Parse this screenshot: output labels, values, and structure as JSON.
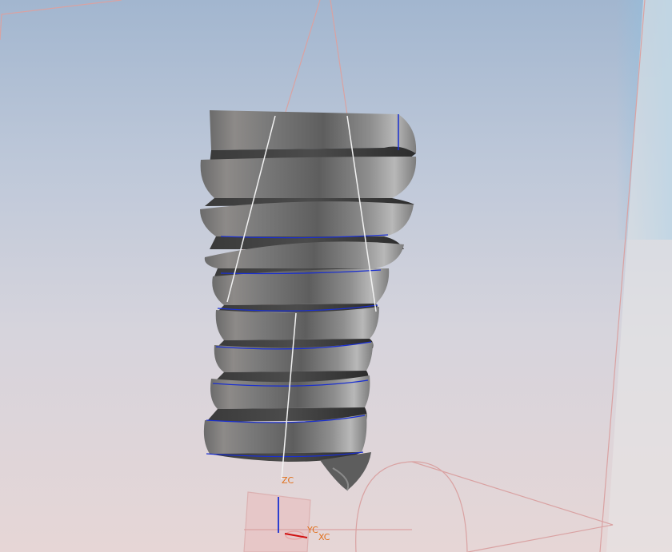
{
  "viewport": {
    "background_top": "#a2b6cf",
    "background_bottom": "#e6d6d6",
    "corner_tint": "#8fc0e0"
  },
  "model": {
    "type": "helical-spring",
    "coil_count": 9,
    "face_color": "#808080",
    "edge_highlight_color": "#1a2fd0"
  },
  "wcs": {
    "z_label": "ZC",
    "y_label": "YC",
    "x_label": "XC",
    "label_color": "#e0701c",
    "z_axis_color": "#1a2fd0",
    "x_axis_color": "#d01010"
  },
  "datum": {
    "line_color": "#d9a2a2",
    "guide_color": "#f2f2f2"
  }
}
